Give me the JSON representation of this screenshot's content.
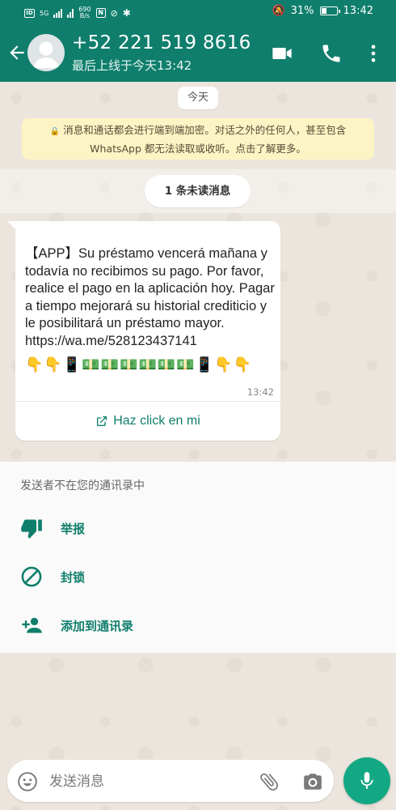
{
  "status_bar": {
    "net_type": "5G",
    "net_speed_value": "690",
    "net_speed_unit": "B/s",
    "battery_percent": "31%",
    "battery_level": 0.31,
    "time": "13:42"
  },
  "header": {
    "contact_name": "+52 221 519 8616",
    "last_seen": "最后上线于今天13:42"
  },
  "chat": {
    "date_chip": "今天",
    "encryption_notice_line1": "消息和通话都会进行端到端加密。对话之外的任何人，甚至包含",
    "encryption_notice_line2": "WhatsApp 都无法读取或收听。点击了解更多。",
    "unread_chip": "1 条未读消息",
    "message": {
      "text": "【APP】Su préstamo vencerá mañana y todavía no recibimos su pago. Por favor, realice el pago en la aplicación hoy. Pagar a tiempo mejorará su historial crediticio y le posibilitará un préstamo mayor.  https://wa.me/528123437141",
      "emoji_line": "👇👇📱💵💵💵💵💵💵📱👇👇",
      "time": "13:42",
      "link_label": "Haz click en mi"
    }
  },
  "unknown_sender": {
    "title": "发送者不在您的通讯录中",
    "actions": [
      {
        "label": "举报",
        "icon": "thumb-down-icon"
      },
      {
        "label": "封锁",
        "icon": "block-icon"
      },
      {
        "label": "添加到通讯录",
        "icon": "add-contact-icon"
      }
    ]
  },
  "composer": {
    "placeholder": "发送消息"
  },
  "colors": {
    "brand": "#0f7e6c",
    "mic": "#13a884",
    "notice_bg": "#fdf4c5"
  }
}
